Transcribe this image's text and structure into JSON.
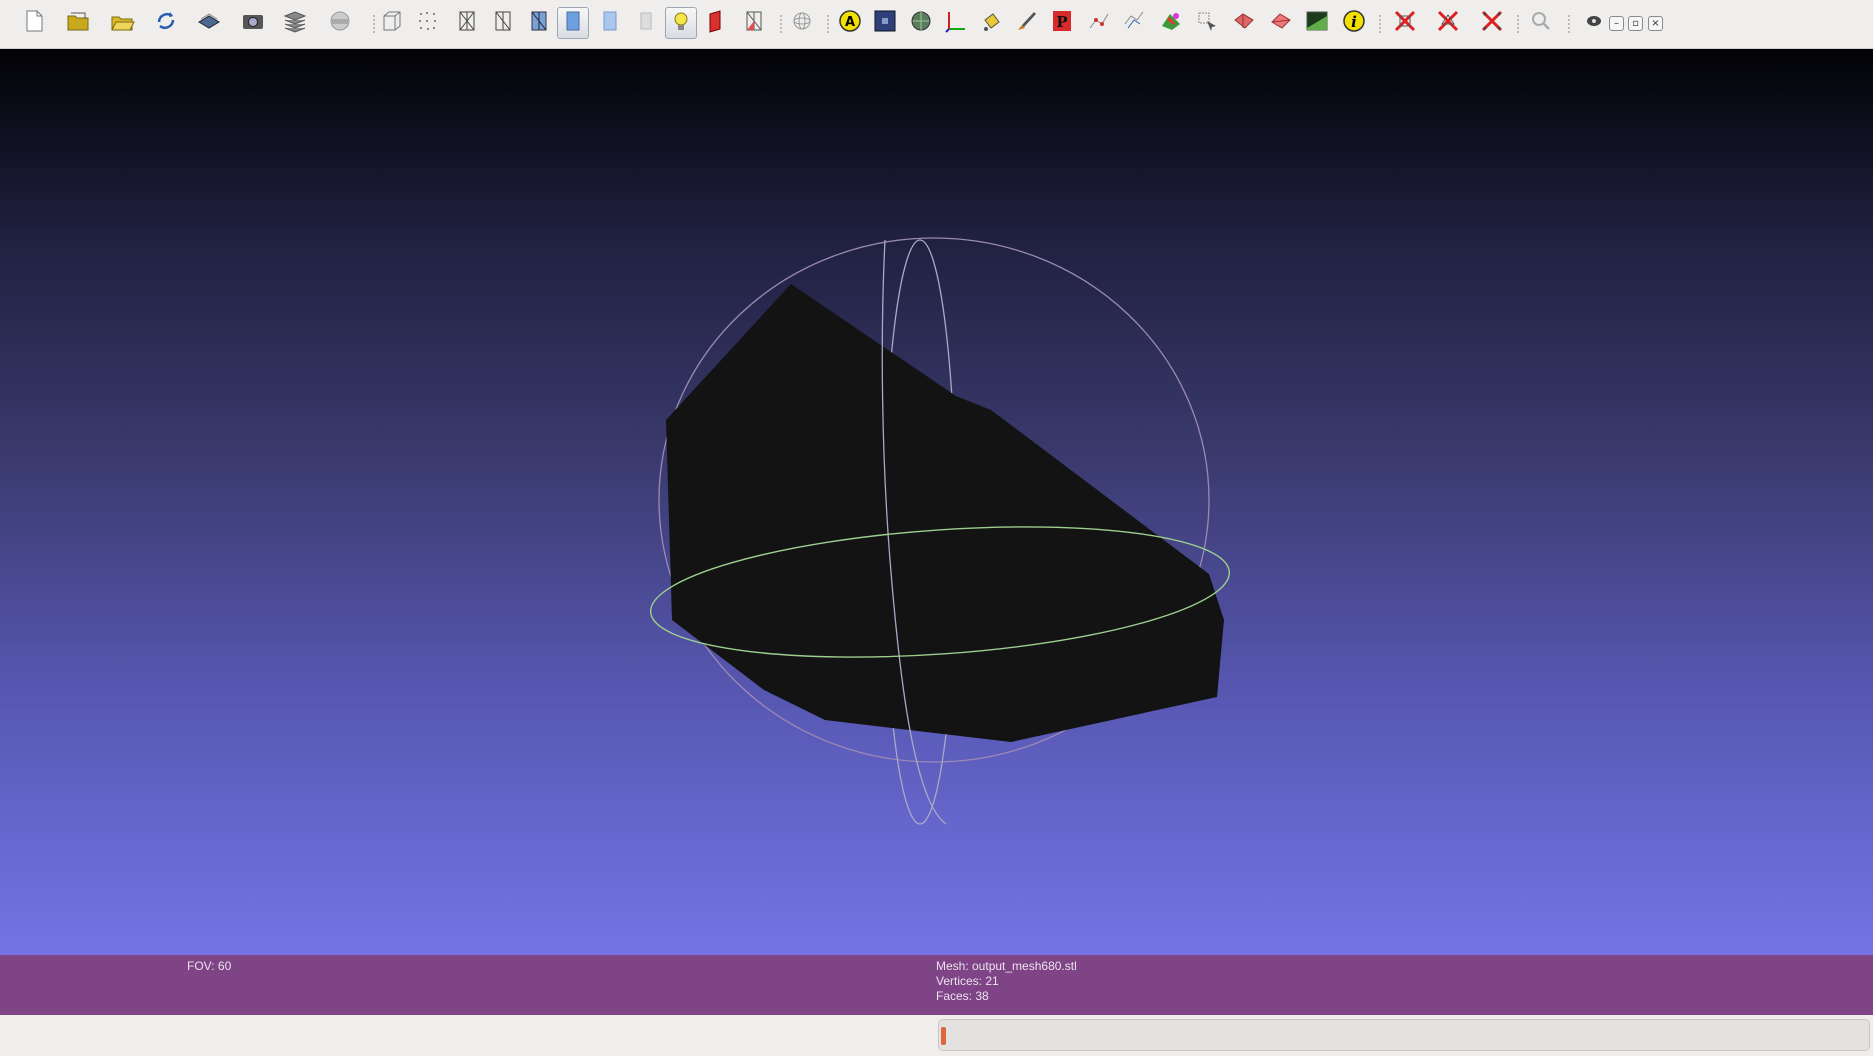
{
  "toolbar": {
    "buttons": [
      {
        "name": "new-project-icon",
        "label": "New Project"
      },
      {
        "name": "open-project-icon",
        "label": "Open Project"
      },
      {
        "name": "import-mesh-icon",
        "label": "Import Mesh"
      },
      {
        "name": "reload-icon",
        "label": "Reload"
      },
      {
        "name": "export-mesh-icon",
        "label": "Export Mesh"
      },
      {
        "name": "snapshot-icon",
        "label": "Save Snapshot"
      },
      {
        "name": "layers-icon",
        "label": "Show Layer Dialog"
      },
      {
        "name": "raster-icon",
        "label": "Show Raster"
      },
      {
        "name": "bbox-icon",
        "label": "Bounding Box"
      },
      {
        "name": "points-icon",
        "label": "Points"
      },
      {
        "name": "wireframe-icon",
        "label": "Wireframe"
      },
      {
        "name": "hidden-lines-icon",
        "label": "Hidden Lines"
      },
      {
        "name": "flat-lines-icon",
        "label": "Flat Lines"
      },
      {
        "name": "flat-icon",
        "label": "Flat"
      },
      {
        "name": "smooth-icon",
        "label": "Smooth"
      },
      {
        "name": "texture-icon",
        "label": "Texture"
      },
      {
        "name": "light-icon",
        "label": "Lighting"
      },
      {
        "name": "backface-icon",
        "label": "Back-face culling"
      },
      {
        "name": "selected-faces-icon",
        "label": "Selected Faces"
      },
      {
        "name": "trackball-icon",
        "label": "Trackball"
      },
      {
        "name": "annotation-icon",
        "label": "Annotation"
      },
      {
        "name": "background-icon",
        "label": "Background"
      },
      {
        "name": "texture-map-icon",
        "label": "Texture Map"
      },
      {
        "name": "axes-icon",
        "label": "Axes"
      },
      {
        "name": "paint-bucket-icon",
        "label": "Paint"
      },
      {
        "name": "brush-icon",
        "label": "Brush"
      },
      {
        "name": "pdf-icon",
        "label": "Parametrization"
      },
      {
        "name": "pick-points-icon",
        "label": "Pick Points"
      },
      {
        "name": "align-icon",
        "label": "Align"
      },
      {
        "name": "color-icon",
        "label": "Vertex Color"
      },
      {
        "name": "select-vertices-icon",
        "label": "Select Vertices"
      },
      {
        "name": "select-faces-icon",
        "label": "Select Faces"
      },
      {
        "name": "select-connected-icon",
        "label": "Select Connected"
      },
      {
        "name": "quality-icon",
        "label": "Quality Map"
      },
      {
        "name": "info-icon",
        "label": "Info"
      },
      {
        "name": "delete-vertices-icon",
        "label": "Delete Vertices"
      },
      {
        "name": "delete-faces-icon",
        "label": "Delete Faces"
      },
      {
        "name": "delete-all-icon",
        "label": "Delete All"
      },
      {
        "name": "search-icon",
        "label": "Search"
      }
    ],
    "window_controls": {
      "minimize": "–",
      "restore": "▫",
      "close": "×"
    }
  },
  "viewport": {
    "background_top": "#020206",
    "background_bottom": "#7474e6",
    "mesh_color": "#131313"
  },
  "info": {
    "fov": "FOV: 60",
    "mesh": "Mesh: output_mesh680.stl",
    "vertices": "Vertices: 21",
    "faces": "Faces: 38"
  },
  "status": {
    "progress_fraction": 0.005,
    "progress_color": "#e0653a"
  }
}
